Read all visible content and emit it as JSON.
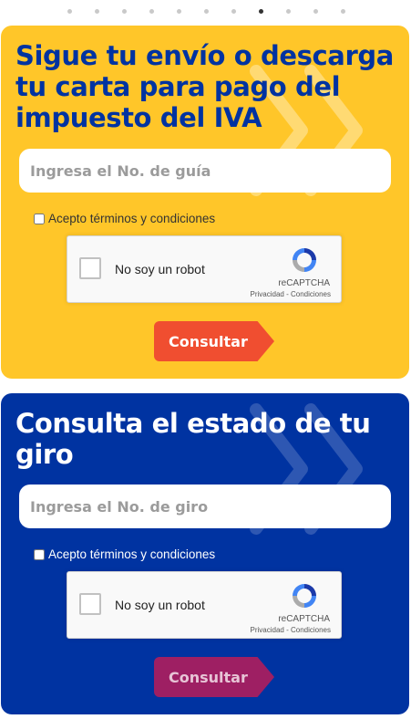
{
  "carousel": {
    "total": 11,
    "active_index": 7
  },
  "colors": {
    "yellow_card": "#FFC629",
    "blue_card": "#0033A1",
    "brand_blue": "#0033A1",
    "orange_button": "#F04E30",
    "magenta_button": "#9E1F63"
  },
  "tracking": {
    "title": "Sigue tu envío o descarga tu carta para pago del impuesto del IVA",
    "input_placeholder": "Ingresa el No. de guía",
    "input_value": "",
    "terms_label": "Acepto términos y condiciones",
    "terms_checked": false,
    "recaptcha": {
      "label": "No soy un robot",
      "brand": "reCAPTCHA",
      "links": "Privacidad - Condiciones",
      "icon": "recaptcha-logo-icon"
    },
    "button_label": "Consultar"
  },
  "giro": {
    "title": "Consulta el estado de tu giro",
    "input_placeholder": "Ingresa el No. de giro",
    "input_value": "",
    "terms_label": "Acepto términos y condiciones",
    "terms_checked": false,
    "recaptcha": {
      "label": "No soy un robot",
      "brand": "reCAPTCHA",
      "links": "Privacidad - Condiciones",
      "icon": "recaptcha-logo-icon"
    },
    "button_label": "Consultar"
  }
}
